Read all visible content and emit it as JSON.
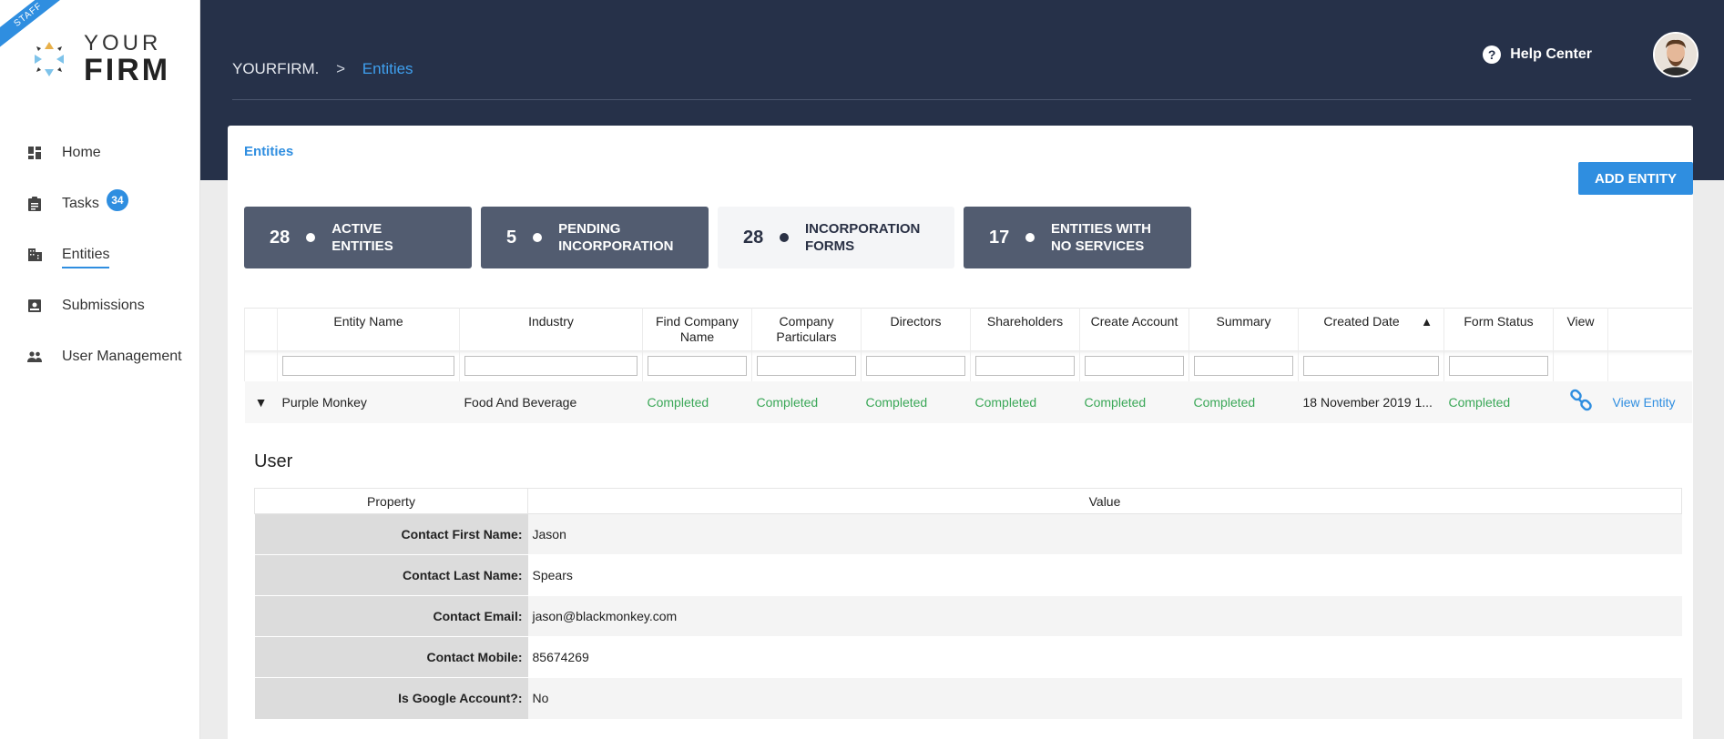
{
  "sidebar": {
    "ribbon": "STAFF",
    "logo_line1": "YOUR",
    "logo_line2": "FIRM",
    "items": [
      {
        "label": "Home",
        "icon": "dashboard-icon"
      },
      {
        "label": "Tasks",
        "icon": "clipboard-icon",
        "badge": "34"
      },
      {
        "label": "Entities",
        "icon": "building-icon",
        "active": true
      },
      {
        "label": "Submissions",
        "icon": "inbox-icon"
      },
      {
        "label": "User Management",
        "icon": "people-icon"
      }
    ]
  },
  "header": {
    "breadcrumb_root": "YOURFIRM.",
    "breadcrumb_sep": ">",
    "breadcrumb_current": "Entities",
    "help_label": "Help Center"
  },
  "main": {
    "title": "Entities",
    "add_button": "ADD ENTITY",
    "stats": [
      {
        "count": "28",
        "label": "ACTIVE ENTITIES"
      },
      {
        "count": "5",
        "label": "PENDING INCORPORATION"
      },
      {
        "count": "28",
        "label": "INCORPORATION FORMS"
      },
      {
        "count": "17",
        "label": "ENTITIES WITH NO SERVICES"
      }
    ],
    "table": {
      "columns": [
        "Entity Name",
        "Industry",
        "Find Company Name",
        "Company Particulars",
        "Directors",
        "Shareholders",
        "Create Account",
        "Summary",
        "Created Date",
        "Form Status",
        "View"
      ],
      "sort_indicator": "▲",
      "row": {
        "entity_name": "Purple Monkey",
        "industry": "Food And Beverage",
        "find_company_name": "Completed",
        "company_particulars": "Completed",
        "directors": "Completed",
        "shareholders": "Completed",
        "create_account": "Completed",
        "summary": "Completed",
        "created_date": "18 November 2019 1...",
        "form_status": "Completed",
        "view_link": "View Entity"
      }
    },
    "detail": {
      "title": "User",
      "col_property": "Property",
      "col_value": "Value",
      "rows": [
        {
          "key": "Contact First Name:",
          "value": "Jason"
        },
        {
          "key": "Contact Last Name:",
          "value": "Spears"
        },
        {
          "key": "Contact Email:",
          "value": "jason@blackmonkey.com"
        },
        {
          "key": "Contact Mobile:",
          "value": "85674269"
        },
        {
          "key": "Is Google Account?:",
          "value": "No"
        }
      ]
    }
  },
  "colors": {
    "accent": "#2f8ee0",
    "header_bg": "#263149",
    "success": "#3aa757"
  }
}
